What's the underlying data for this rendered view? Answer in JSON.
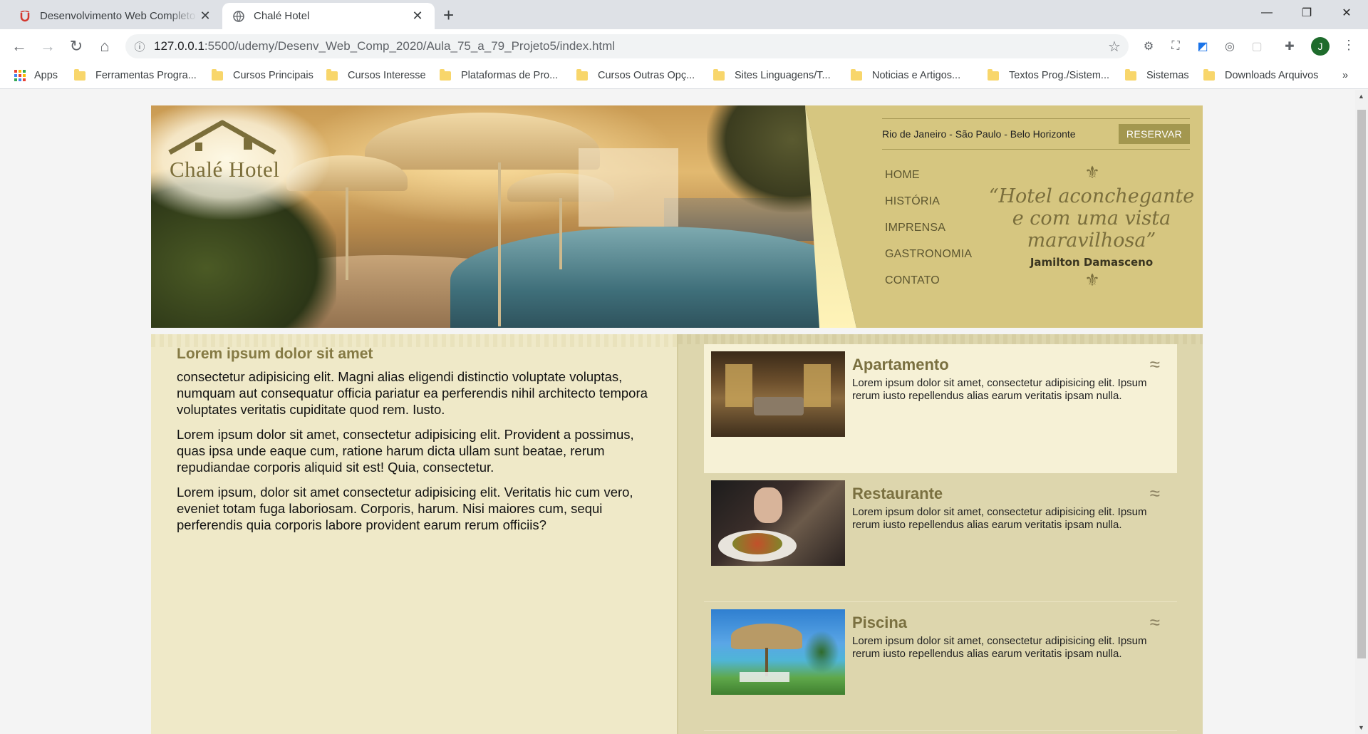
{
  "browser": {
    "tabs": [
      {
        "title": "Desenvolvimento Web Completo",
        "favicon": "udemy-icon",
        "active": false
      },
      {
        "title": "Chalé Hotel",
        "favicon": "globe-icon",
        "active": true
      }
    ],
    "url_host": "127.0.0.1",
    "url_path": ":5500/udemy/Desenv_Web_Comp_2020/Aula_75_a_79_Projeto5/index.html",
    "avatar_letter": "J",
    "bookmarks": [
      {
        "label": "Apps",
        "type": "apps"
      },
      {
        "label": "Ferramentas Progra...",
        "type": "folder"
      },
      {
        "label": "Cursos Principais",
        "type": "folder"
      },
      {
        "label": "Cursos Interesse",
        "type": "folder"
      },
      {
        "label": "Plataformas de Pro...",
        "type": "folder"
      },
      {
        "label": "Cursos Outras Opç...",
        "type": "folder"
      },
      {
        "label": "Sites Linguagens/T...",
        "type": "folder"
      },
      {
        "label": "Noticias e Artigos...",
        "type": "folder"
      },
      {
        "label": "Textos Prog./Sistem...",
        "type": "folder"
      },
      {
        "label": "Sistemas",
        "type": "folder"
      },
      {
        "label": "Downloads Arquivos",
        "type": "folder"
      }
    ],
    "more_bookmarks": "»"
  },
  "site": {
    "logo_text": "Chalé Hotel",
    "cities": "Rio de Janeiro - São Paulo - Belo Horizonte",
    "reserve_label": "RESERVAR",
    "nav": [
      "HOME",
      "HISTÓRIA",
      "IMPRENSA",
      "GASTRONOMIA",
      "CONTATO"
    ],
    "quote": {
      "ornament_top": "⚜",
      "text": "“Hotel aconchegante e com uma vista maravilhosa”",
      "author": "Jamilton Damasceno",
      "ornament_bottom": "⚜"
    },
    "intro": {
      "title": "Lorem ipsum dolor sit amet",
      "paragraphs": [
        "consectetur adipisicing elit. Magni alias eligendi distinctio voluptate voluptas, numquam aut consequatur officia pariatur ea perferendis nihil architecto tempora voluptates veritatis cupiditate quod rem. Iusto.",
        "Lorem ipsum dolor sit amet, consectetur adipisicing elit. Provident a possimus, quas ipsa unde eaque cum, ratione harum dicta ullam sunt beatae, rerum repudiandae corporis aliquid sit est! Quia, consectetur.",
        "Lorem ipsum, dolor sit amet consectetur adipisicing elit. Veritatis hic cum vero, eveniet totam fuga laboriosam. Corporis, harum. Nisi maiores cum, sequi perferendis quia corporis labore provident earum rerum officiis?"
      ]
    },
    "cards": [
      {
        "title": "Apartamento",
        "text": "Lorem ipsum dolor sit amet, consectetur adipisicing elit. Ipsum rerum iusto repellendus alias earum veritatis ipsam nulla.",
        "image": "apartment-photo"
      },
      {
        "title": "Restaurante",
        "text": "Lorem ipsum dolor sit amet, consectetur adipisicing elit. Ipsum rerum iusto repellendus alias earum veritatis ipsam nulla.",
        "image": "restaurant-photo"
      },
      {
        "title": "Piscina",
        "text": "Lorem ipsum dolor sit amet, consectetur adipisicing elit. Ipsum rerum iusto repellendus alias earum veritatis ipsam nulla.",
        "image": "pool-photo"
      }
    ],
    "card_wave": "≈"
  },
  "colors": {
    "header_bg": "#d6c680",
    "button_bg": "#a3974f",
    "left_column": "#efe9c8",
    "right_column": "#ddd6ad",
    "heading": "#857a44"
  }
}
